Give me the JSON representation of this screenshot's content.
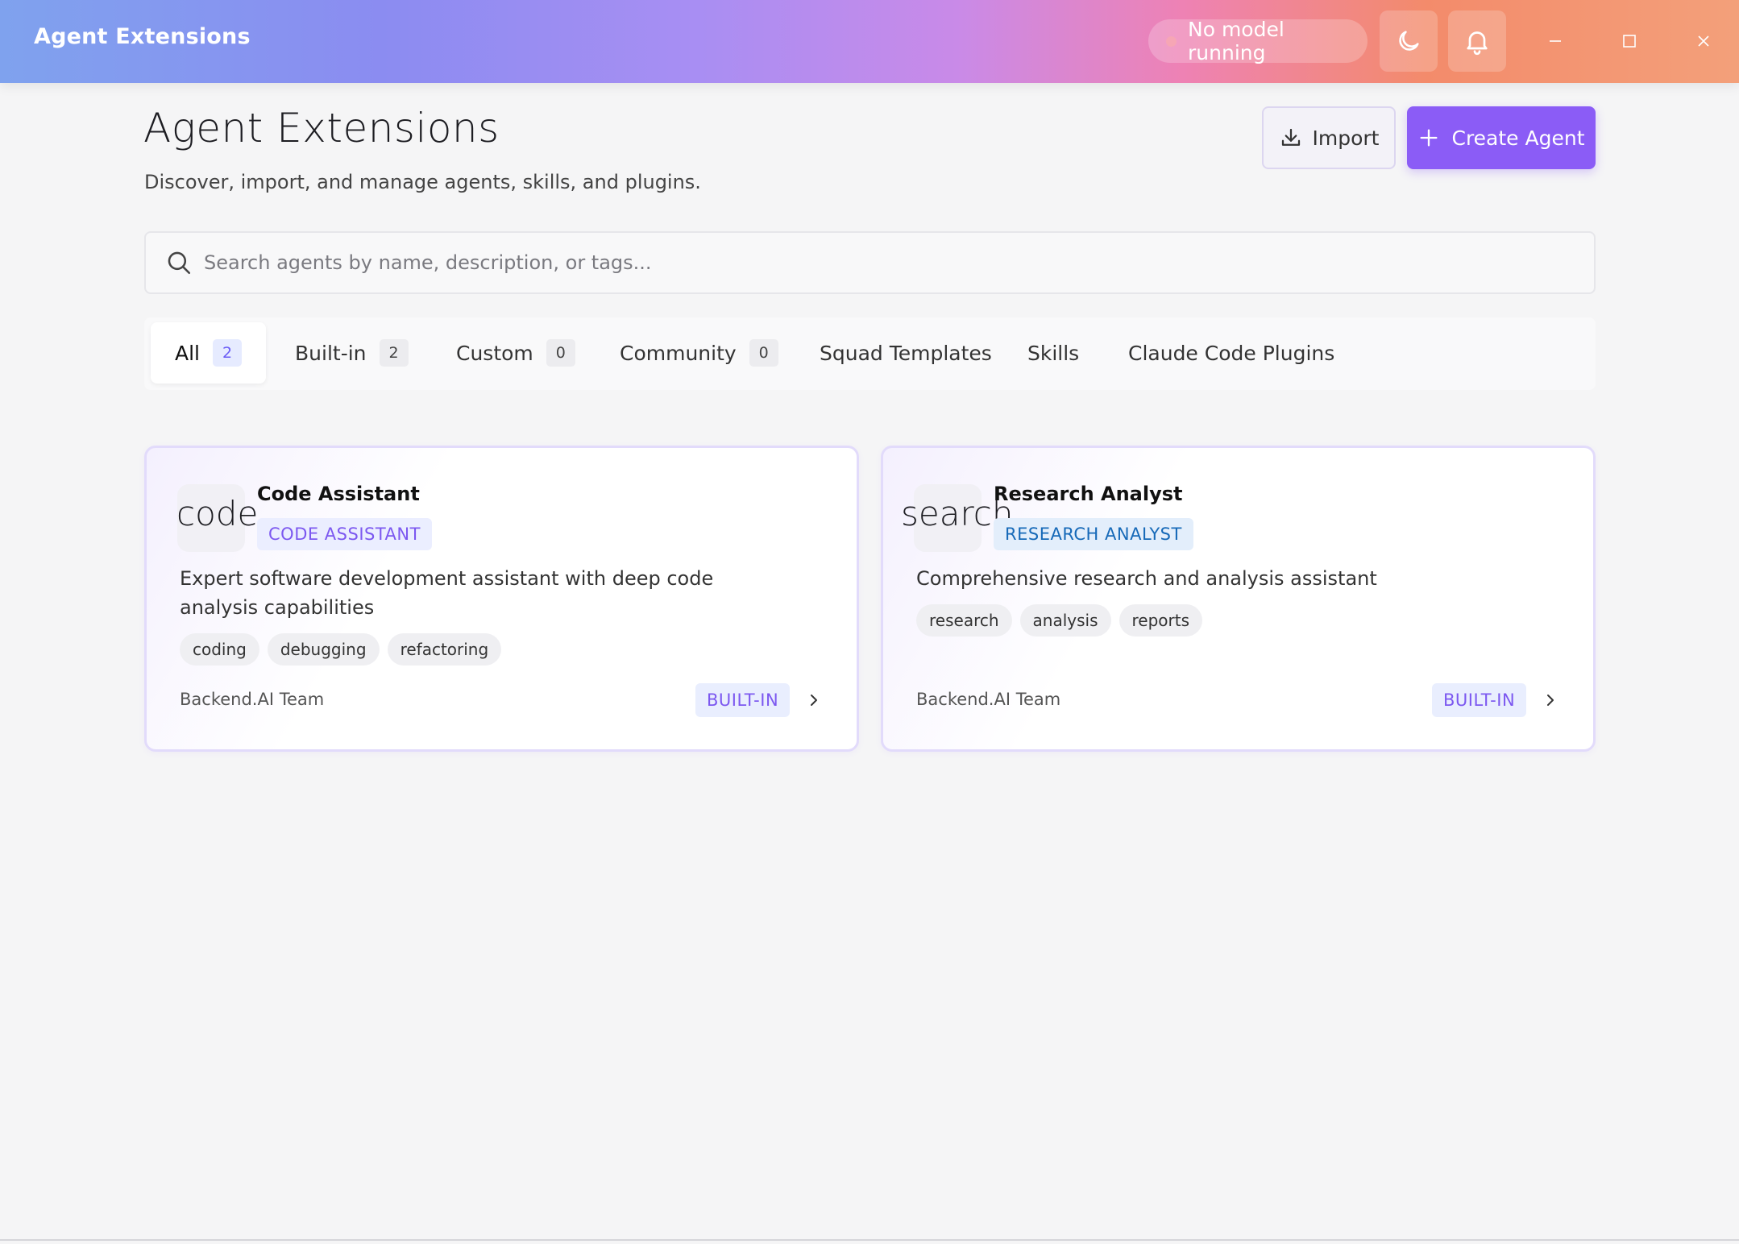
{
  "window": {
    "title": "Agent Extensions",
    "model_status": "No model running",
    "gradient_colors": [
      "#7fa2ee",
      "#a88ef3",
      "#ee82b4",
      "#f3a07a"
    ]
  },
  "header": {
    "title": "Agent Extensions",
    "subtitle": "Discover, import, and manage agents, skills, and plugins.",
    "import_label": "Import",
    "create_label": "Create Agent",
    "accent_color": "#8b5cf6"
  },
  "search": {
    "placeholder": "Search agents by name, description, or tags..."
  },
  "tabs": [
    {
      "label": "All",
      "count": "2"
    },
    {
      "label": "Built-in",
      "count": "2"
    },
    {
      "label": "Custom",
      "count": "0"
    },
    {
      "label": "Community",
      "count": "0"
    },
    {
      "label": "Squad Templates"
    },
    {
      "label": "Skills"
    },
    {
      "label": "Claude Code Plugins"
    }
  ],
  "agents": [
    {
      "icon": "code",
      "name": "Code Assistant",
      "type": "CODE ASSISTANT",
      "type_color": "#7c58f0",
      "type_bg": "#ebeeff",
      "description": "Expert software development assistant with deep code analysis capabilities",
      "tags": [
        "coding",
        "debugging",
        "refactoring"
      ],
      "author": "Backend.AI Team",
      "badge": "BUILT-IN"
    },
    {
      "icon": "search",
      "name": "Research Analyst",
      "type": "RESEARCH ANALYST",
      "type_color": "#1669b8",
      "type_bg": "#e3eefb",
      "description": "Comprehensive research and analysis assistant",
      "tags": [
        "research",
        "analysis",
        "reports"
      ],
      "author": "Backend.AI Team",
      "badge": "BUILT-IN"
    }
  ]
}
